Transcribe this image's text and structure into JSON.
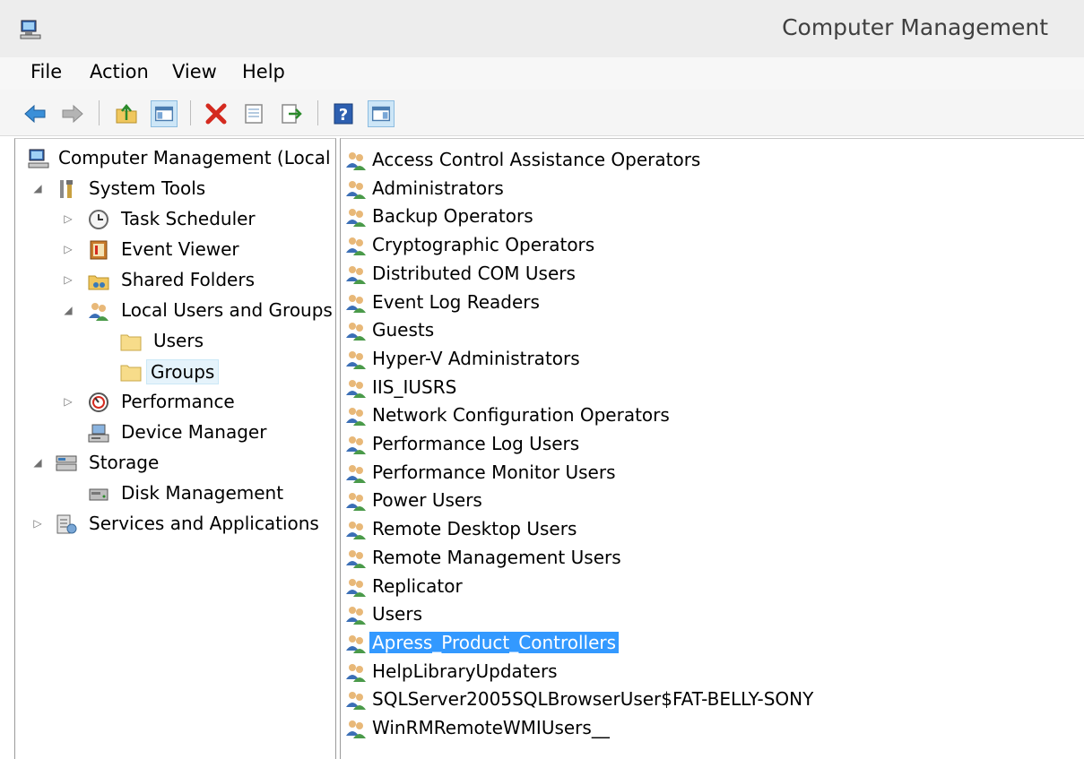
{
  "window": {
    "title": "Computer Management"
  },
  "menu": [
    "File",
    "Action",
    "View",
    "Help"
  ],
  "toolbar": {
    "buttons": [
      "back",
      "forward",
      "up-folder",
      "show-hide-tree",
      "delete",
      "properties",
      "export-list",
      "help",
      "show-hide-action-pane"
    ]
  },
  "tree": {
    "root": "Computer Management (Local",
    "system_tools": "System Tools",
    "task_scheduler": "Task Scheduler",
    "event_viewer": "Event Viewer",
    "shared_folders": "Shared Folders",
    "local_users_groups": "Local Users and Groups",
    "users": "Users",
    "groups": "Groups",
    "performance": "Performance",
    "device_manager": "Device Manager",
    "storage": "Storage",
    "disk_management": "Disk Management",
    "services_apps": "Services and Applications"
  },
  "groups": [
    "Access Control Assistance Operators",
    "Administrators",
    "Backup Operators",
    "Cryptographic Operators",
    "Distributed COM Users",
    "Event Log Readers",
    "Guests",
    "Hyper-V Administrators",
    "IIS_IUSRS",
    "Network Configuration Operators",
    "Performance Log Users",
    "Performance Monitor Users",
    "Power Users",
    "Remote Desktop Users",
    "Remote Management Users",
    "Replicator",
    "Users",
    "Apress_Product_Controllers",
    "HelpLibraryUpdaters",
    "SQLServer2005SQLBrowserUser$FAT-BELLY-SONY",
    "WinRMRemoteWMIUsers__"
  ],
  "selected_group": "Apress_Product_Controllers",
  "colors": {
    "selection": "#3399ff",
    "tree_selected": "#e5f3fb"
  }
}
